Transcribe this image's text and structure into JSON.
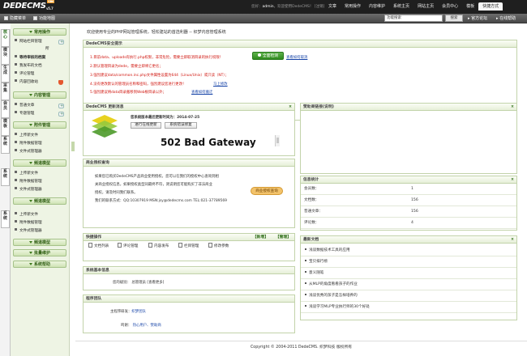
{
  "app": {
    "logo_text": "DEDECMS",
    "version": "v5.7",
    "beta_badge": "GBK"
  },
  "topbar": {
    "welcome_prefix": "您好：",
    "user": "admin",
    "welcome_suffix": "，欢迎使用DedeCMS！ [注销]",
    "tabs": [
      {
        "label": "文章"
      },
      {
        "label": "常用操作"
      },
      {
        "label": "内容维护"
      },
      {
        "label": "系统主页"
      },
      {
        "label": "网站主页"
      },
      {
        "label": "会员中心"
      },
      {
        "label": "模板"
      },
      {
        "label": "快捷方式"
      }
    ]
  },
  "subbar": {
    "hide_menu": "隐藏菜单",
    "function_map": "功能地图",
    "search_value": "功能搜索",
    "search_button": "搜索",
    "official_forum": "官方论坛",
    "online_help": "在线帮助"
  },
  "sidetabs": [
    {
      "label": "核心"
    },
    {
      "label": "模块"
    },
    {
      "label": "生成"
    },
    {
      "label": "采集"
    },
    {
      "label": "会员"
    },
    {
      "label": "模板"
    },
    {
      "label": "系统"
    },
    {
      "label": "系统"
    },
    {
      "label": "系统"
    }
  ],
  "sidebar": {
    "groups": [
      {
        "title": "常用操作"
      },
      {
        "title": "内容管理"
      },
      {
        "title": "附件管理"
      },
      {
        "title": "频道模型"
      },
      {
        "title": "频道模型"
      },
      {
        "title": "频道模型"
      },
      {
        "title": "批量维护"
      },
      {
        "title": "系统帮助"
      }
    ],
    "items_common": [
      "网站栏目管理",
      "所",
      "等待审核的档案",
      "我发布的文档",
      "评论管理",
      "内容回收站"
    ],
    "items_content": [
      "普通文章",
      "专题管理"
    ],
    "items_attach": [
      "上传新文件",
      "附件数据管理",
      "文件式管理器"
    ],
    "items_model": [
      "上传新文件",
      "附件数据管理",
      "文件式管理器"
    ],
    "items_model2": [
      "上传新文件",
      "附件数据管理",
      "文件式管理器"
    ]
  },
  "main": {
    "intro": "欢迎使用专业的PHP网站管理系统，轻松建站的首选利器 -- 织梦内容管理系统",
    "security": {
      "title": "DedeCMS安全提示",
      "line1": "1.目前data、uploads有执行.php权限，非常危险，需要立即取消目录的执行权限！",
      "line1_link": "查看如何取消",
      "line2": "2.默认管理目录为dede，需要立即将它更名；",
      "line3": "3.强烈建议data/common.inc.php文件属性设置为644（Linux/Unix）或只读（NT）；",
      "line4": "4.没有更改默认的管理员名称和密码，强烈建议您进行更改！",
      "line4_link": "马上修改",
      "line5": "5.强烈建议将data目录搬移到Web根目录以外；",
      "line5_link": "查看如何搬迁",
      "check_button": "全面检测"
    },
    "update": {
      "title": "DedeCMS 更新消息",
      "close": "×",
      "version_line": "您系统版本最后更新时间为：2014-07-25",
      "online_update": "进行在线更新",
      "fix_update": "系统错误修复",
      "error_text": "502 Bad Gateway"
    },
    "sponsor": {
      "title": "赞助商链接(说明)",
      "close": "×"
    },
    "license": {
      "title": "商业授权查询",
      "p1": "如果您已购买DedeCMS产品商业使用授权，您可以在我们的授权中心查询到相",
      "p2": "关商业授权信息，如果授权类型同最终不符，则说明您可能购买了非法商业",
      "p3": "授权，请及时同我们联系。",
      "contact": "我们的联系方式：QQ:10307919 MSN:jsy@dedecms.com TEL:021-37789569",
      "buy_button": "商业授权查询"
    },
    "stats": {
      "title": "信息统计",
      "close": "×",
      "rows": [
        {
          "k": "会员数：",
          "v": "1"
        },
        {
          "k": "文档数：",
          "v": "156"
        },
        {
          "k": "普通文章：",
          "v": "156"
        },
        {
          "k": "评论数：",
          "v": "4"
        }
      ]
    },
    "quick": {
      "title": "快捷操作",
      "new": "【新增】",
      "manage": "【管理】",
      "items": [
        "文档列表",
        "评论管理",
        "内容发布",
        "栏目管理",
        "修改参数"
      ]
    },
    "latest": {
      "title": "最新文档",
      "close": "×",
      "items": [
        "浅谈数据技术工具的应用",
        "宝贝排行榜",
        "意义随笔",
        "从MLP的角度看看孩子的作业",
        "浅谈优秀的孩子是怎样培养的",
        "浅谈学习MLP专业执行师的30个好处"
      ]
    },
    "sysinfo": {
      "title": "系统基本信息",
      "label": "您的级别：",
      "value": "总管理员",
      "more": "[查看更多]"
    },
    "team": {
      "title": "程序团队",
      "r1_label": "主程序研发：",
      "r1_value": "织梦团队",
      "r2_label": "鸣谢：",
      "r2_value": "热心用户、赞助商"
    },
    "footer": "Copyright © 2004-2011 DedeCMS. 织梦科技 版权所有"
  }
}
